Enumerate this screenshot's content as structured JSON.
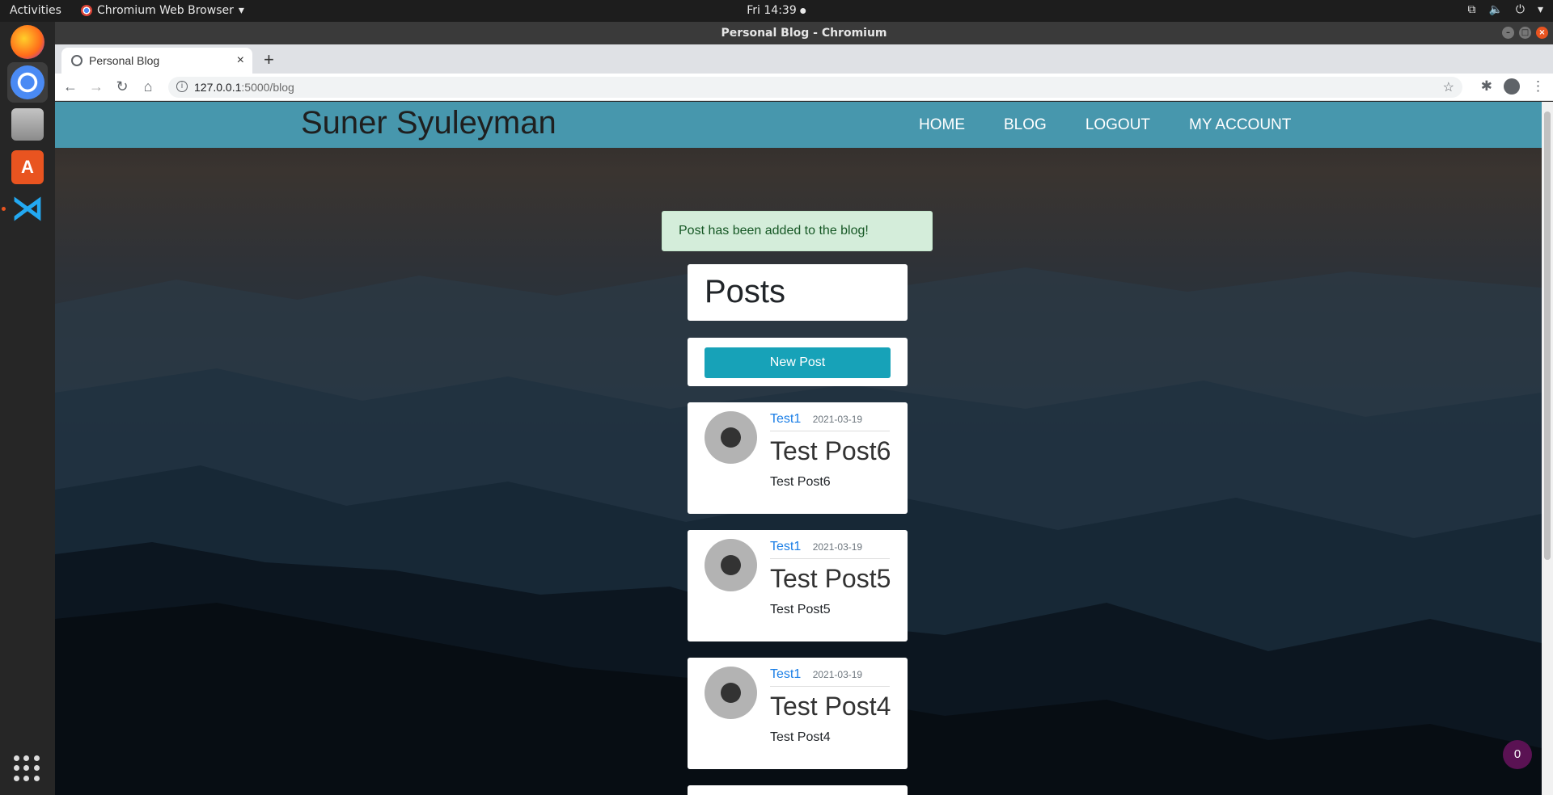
{
  "system": {
    "activities": "Activities",
    "app_menu": "Chromium Web Browser",
    "clock": "Fri 14:39"
  },
  "window": {
    "title": "Personal Blog - Chromium"
  },
  "browser": {
    "tab_title": "Personal Blog",
    "url_host": "127.0.0.1",
    "url_path": ":5000/blog"
  },
  "site": {
    "brand": "Suner Syuleyman",
    "nav": [
      "HOME",
      "BLOG",
      "LOGOUT",
      "MY ACCOUNT"
    ],
    "flash_message": "Post has been added to the blog!",
    "posts_heading": "Posts",
    "new_post_label": "New Post",
    "posts": [
      {
        "author": "Test1",
        "date": "2021-03-19",
        "title": "Test Post6",
        "body": "Test Post6"
      },
      {
        "author": "Test1",
        "date": "2021-03-19",
        "title": "Test Post5",
        "body": "Test Post5"
      },
      {
        "author": "Test1",
        "date": "2021-03-19",
        "title": "Test Post4",
        "body": "Test Post4"
      }
    ],
    "notification_count": "0"
  }
}
